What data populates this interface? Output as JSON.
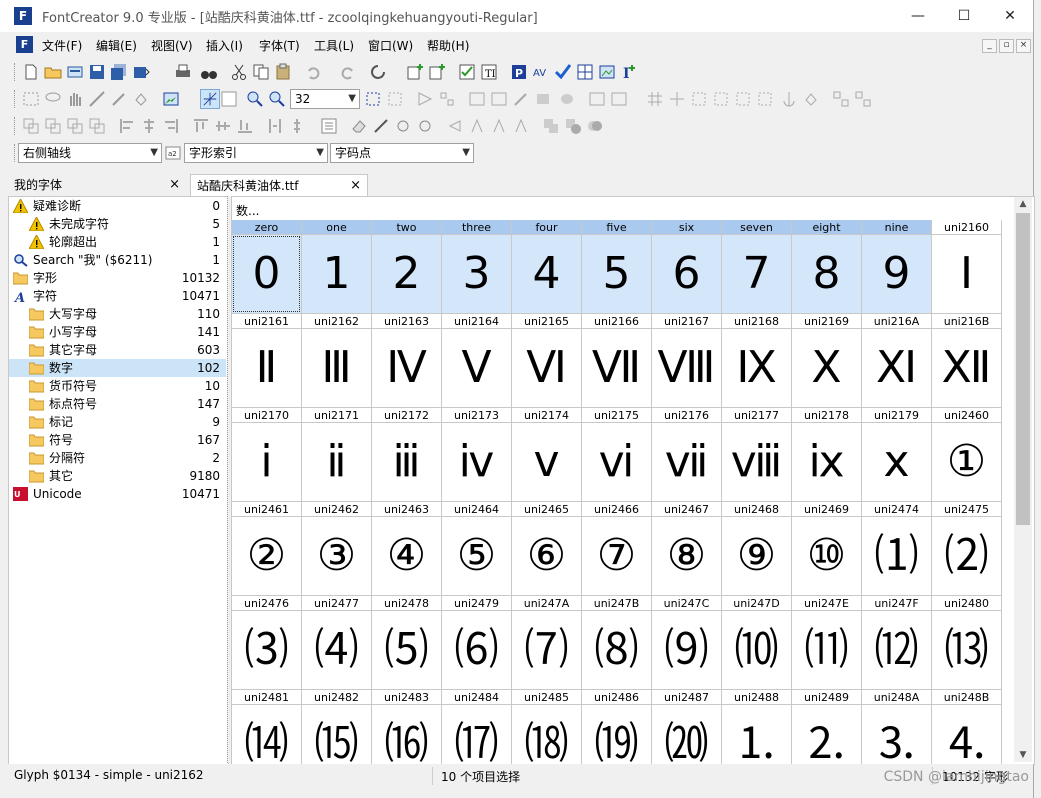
{
  "window": {
    "title": "FontCreator 9.0 专业版 - [站酷庆科黄油体.ttf - zcoolqingkehuangyouti-Regular]",
    "app_icon": "F",
    "controls": [
      "—",
      "☐",
      "✕"
    ]
  },
  "menubar": {
    "items": [
      "文件(F)",
      "编辑(E)",
      "视图(V)",
      "插入(I)",
      "字体(T)",
      "工具(L)",
      "窗口(W)",
      "帮助(H)"
    ],
    "mdi_controls": [
      "_",
      "▫",
      "×"
    ]
  },
  "toolbar": {
    "zoom_value": "32",
    "combo_guideline": "右侧轴线",
    "combo_index": "字形索引",
    "combo_codepoint": "字码点"
  },
  "tabs": [
    {
      "label": "我的字体",
      "close": "×"
    },
    {
      "label": "站酷庆科黄油体.ttf",
      "close": "×"
    }
  ],
  "tree": [
    {
      "label": "疑难诊断",
      "count": "0",
      "icon": "warning-icon",
      "indent": 0
    },
    {
      "label": "未完成字符",
      "count": "5",
      "icon": "warning-icon",
      "indent": 1
    },
    {
      "label": "轮廓超出",
      "count": "1",
      "icon": "warning-icon",
      "indent": 1
    },
    {
      "label": "Search \"我\" ($6211)",
      "count": "1",
      "icon": "search-icon",
      "indent": 0
    },
    {
      "label": "字形",
      "count": "10132",
      "icon": "folder-icon",
      "indent": 0
    },
    {
      "label": "字符",
      "count": "10471",
      "icon": "font-a-icon",
      "indent": 0
    },
    {
      "label": "大写字母",
      "count": "110",
      "icon": "folder-icon",
      "indent": 1
    },
    {
      "label": "小写字母",
      "count": "141",
      "icon": "folder-icon",
      "indent": 1
    },
    {
      "label": "其它字母",
      "count": "603",
      "icon": "folder-icon",
      "indent": 1
    },
    {
      "label": "数字",
      "count": "102",
      "icon": "folder-icon",
      "indent": 1,
      "selected": true
    },
    {
      "label": "货币符号",
      "count": "10",
      "icon": "folder-icon",
      "indent": 1
    },
    {
      "label": "标点符号",
      "count": "147",
      "icon": "folder-icon",
      "indent": 1
    },
    {
      "label": "标记",
      "count": "9",
      "icon": "folder-icon",
      "indent": 1
    },
    {
      "label": "符号",
      "count": "167",
      "icon": "folder-icon",
      "indent": 1
    },
    {
      "label": "分隔符",
      "count": "2",
      "icon": "folder-icon",
      "indent": 1
    },
    {
      "label": "其它",
      "count": "9180",
      "icon": "folder-icon",
      "indent": 1
    },
    {
      "label": "Unicode",
      "count": "10471",
      "icon": "unicode-icon",
      "indent": 0
    }
  ],
  "grid": {
    "title": "数...",
    "cells": [
      {
        "name": "zero",
        "glyph": "0",
        "hl": true
      },
      {
        "name": "one",
        "glyph": "1",
        "hl": true
      },
      {
        "name": "two",
        "glyph": "2",
        "hl": true
      },
      {
        "name": "three",
        "glyph": "3",
        "hl": true
      },
      {
        "name": "four",
        "glyph": "4",
        "hl": true
      },
      {
        "name": "five",
        "glyph": "5",
        "hl": true
      },
      {
        "name": "six",
        "glyph": "6",
        "hl": true
      },
      {
        "name": "seven",
        "glyph": "7",
        "hl": true
      },
      {
        "name": "eight",
        "glyph": "8",
        "hl": true
      },
      {
        "name": "nine",
        "glyph": "9",
        "hl": true
      },
      {
        "name": "uni2160",
        "glyph": "Ⅰ"
      },
      {
        "name": "uni2161",
        "glyph": "Ⅱ"
      },
      {
        "name": "uni2162",
        "glyph": "Ⅲ"
      },
      {
        "name": "uni2163",
        "glyph": "Ⅳ"
      },
      {
        "name": "uni2164",
        "glyph": "Ⅴ"
      },
      {
        "name": "uni2165",
        "glyph": "Ⅵ"
      },
      {
        "name": "uni2166",
        "glyph": "Ⅶ"
      },
      {
        "name": "uni2167",
        "glyph": "Ⅷ"
      },
      {
        "name": "uni2168",
        "glyph": "Ⅸ"
      },
      {
        "name": "uni2169",
        "glyph": "Ⅹ"
      },
      {
        "name": "uni216A",
        "glyph": "Ⅺ"
      },
      {
        "name": "uni216B",
        "glyph": "Ⅻ"
      },
      {
        "name": "uni2170",
        "glyph": "ⅰ"
      },
      {
        "name": "uni2171",
        "glyph": "ⅱ"
      },
      {
        "name": "uni2172",
        "glyph": "ⅲ"
      },
      {
        "name": "uni2173",
        "glyph": "ⅳ"
      },
      {
        "name": "uni2174",
        "glyph": "ⅴ"
      },
      {
        "name": "uni2175",
        "glyph": "ⅵ"
      },
      {
        "name": "uni2176",
        "glyph": "ⅶ"
      },
      {
        "name": "uni2177",
        "glyph": "ⅷ"
      },
      {
        "name": "uni2178",
        "glyph": "ⅸ"
      },
      {
        "name": "uni2179",
        "glyph": "ⅹ"
      },
      {
        "name": "uni2460",
        "glyph": "①"
      },
      {
        "name": "uni2461",
        "glyph": "②"
      },
      {
        "name": "uni2462",
        "glyph": "③"
      },
      {
        "name": "uni2463",
        "glyph": "④"
      },
      {
        "name": "uni2464",
        "glyph": "⑤"
      },
      {
        "name": "uni2465",
        "glyph": "⑥"
      },
      {
        "name": "uni2466",
        "glyph": "⑦"
      },
      {
        "name": "uni2467",
        "glyph": "⑧"
      },
      {
        "name": "uni2468",
        "glyph": "⑨"
      },
      {
        "name": "uni2469",
        "glyph": "⑩"
      },
      {
        "name": "uni2474",
        "glyph": "⑴"
      },
      {
        "name": "uni2475",
        "glyph": "⑵"
      },
      {
        "name": "uni2476",
        "glyph": "⑶"
      },
      {
        "name": "uni2477",
        "glyph": "⑷"
      },
      {
        "name": "uni2478",
        "glyph": "⑸"
      },
      {
        "name": "uni2479",
        "glyph": "⑹"
      },
      {
        "name": "uni247A",
        "glyph": "⑺"
      },
      {
        "name": "uni247B",
        "glyph": "⑻"
      },
      {
        "name": "uni247C",
        "glyph": "⑼"
      },
      {
        "name": "uni247D",
        "glyph": "⑽"
      },
      {
        "name": "uni247E",
        "glyph": "⑾"
      },
      {
        "name": "uni247F",
        "glyph": "⑿"
      },
      {
        "name": "uni2480",
        "glyph": "⒀"
      },
      {
        "name": "uni2481",
        "glyph": "⒁"
      },
      {
        "name": "uni2482",
        "glyph": "⒂"
      },
      {
        "name": "uni2483",
        "glyph": "⒃"
      },
      {
        "name": "uni2484",
        "glyph": "⒄"
      },
      {
        "name": "uni2485",
        "glyph": "⒅"
      },
      {
        "name": "uni2486",
        "glyph": "⒆"
      },
      {
        "name": "uni2487",
        "glyph": "⒇"
      },
      {
        "name": "uni2488",
        "glyph": "⒈"
      },
      {
        "name": "uni2489",
        "glyph": "⒉"
      },
      {
        "name": "uni248A",
        "glyph": "⒊"
      },
      {
        "name": "uni248B",
        "glyph": "⒋"
      }
    ]
  },
  "statusbar": {
    "glyph_info": "Glyph $0134 - simple - uni2162",
    "selection": "10 个项目选择",
    "total": "10132 字形"
  },
  "watermark": "CSDN @iamhijingtao",
  "colors": {
    "selected_label": "#a9c9ef",
    "selected_cell": "#d4e6fa",
    "tree_selection": "#cce4f7",
    "app_icon": "#1a3f8f"
  }
}
